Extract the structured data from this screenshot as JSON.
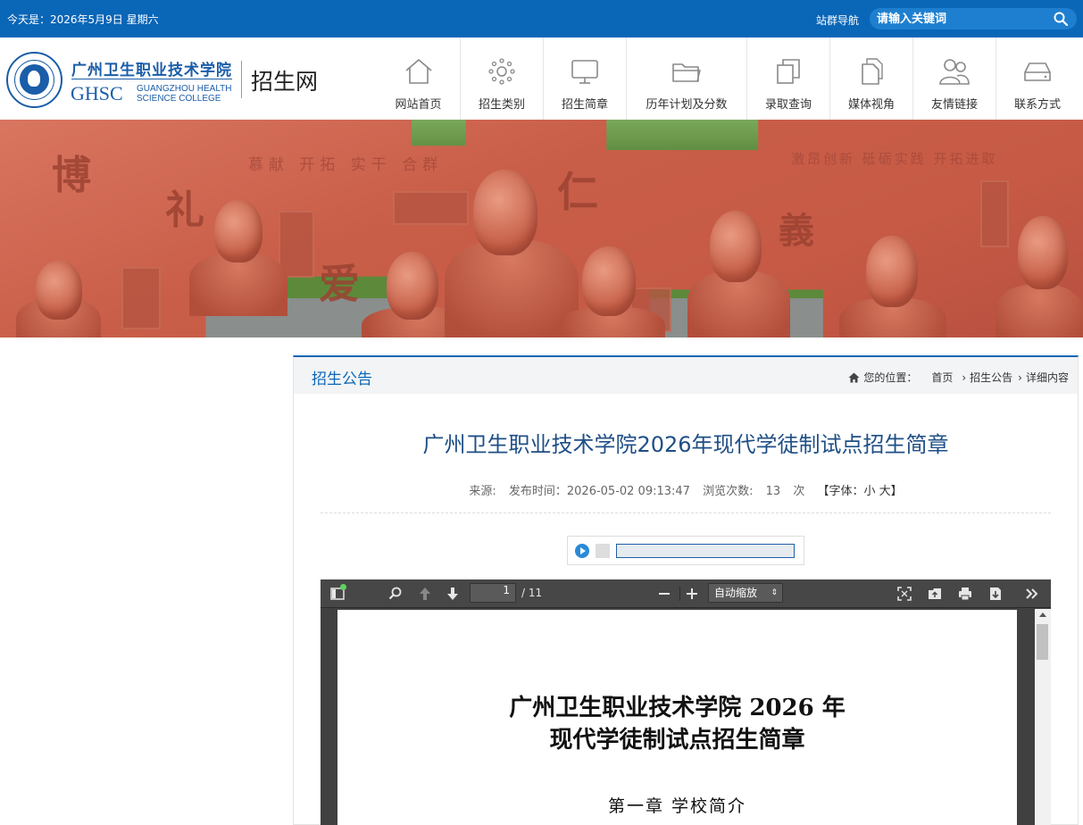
{
  "topbar": {
    "date_text": "今天是：2026年5月9日 星期六",
    "site_nav": "站群导航",
    "search_placeholder": "请输入关键词"
  },
  "header": {
    "logo_cn": "广州卫生职业技术学院",
    "logo_en": "GHSC",
    "logo_en_line1": "GUANGZHOU HEALTH",
    "logo_en_line2": "SCIENCE COLLEGE",
    "site_name": "招生网"
  },
  "nav": [
    {
      "label": "网站首页",
      "icon": "home-icon"
    },
    {
      "label": "招生类别",
      "icon": "gear-dots-icon"
    },
    {
      "label": "招生简章",
      "icon": "monitor-icon"
    },
    {
      "label": "历年计划及分数",
      "icon": "folder-icon"
    },
    {
      "label": "录取查询",
      "icon": "copy-icon"
    },
    {
      "label": "媒体视角",
      "icon": "document-icon"
    },
    {
      "label": "友情链接",
      "icon": "users-icon"
    },
    {
      "label": "联系方式",
      "icon": "drive-icon"
    }
  ],
  "banner": {
    "slogan_left": "慕献 开拓 实干 合群",
    "slogan_right": "激昂创新 砥砺实践 开拓进取",
    "glyphs": [
      "博",
      "礼",
      "爱",
      "仁",
      "義"
    ]
  },
  "panel": {
    "category": "招生公告",
    "breadcrumb_label": "您的位置：",
    "breadcrumb_home": "首页",
    "breadcrumb_sep1": "›",
    "breadcrumb_cat": "招生公告",
    "breadcrumb_sep2": "›",
    "breadcrumb_detail": "详细内容"
  },
  "article": {
    "title": "广州卫生职业技术学院2026年现代学徒制试点招生简章",
    "source_label": "来源:",
    "publish_label": "发布时间：",
    "publish_time": "2026-05-02 09:13:47",
    "views_label": "浏览次数:",
    "views": "13",
    "views_unit": "次",
    "font_label": "【字体：",
    "font_small": "小",
    "font_large": "大",
    "font_close": "】"
  },
  "pdf": {
    "page_current": "1",
    "page_total": "/ 11",
    "zoom": "自动缩放",
    "doc_title_line1": "广州卫生职业技术学院 2026 年",
    "doc_title_line2": "现代学徒制试点招生简章",
    "doc_chapter": "第一章  学校简介"
  },
  "colors": {
    "primary": "#0a66b7",
    "title": "#1f4f86",
    "pdf_toolbar": "#474747"
  }
}
